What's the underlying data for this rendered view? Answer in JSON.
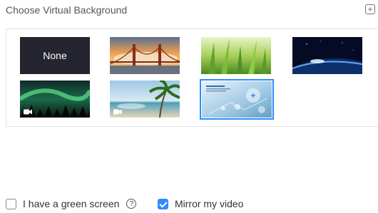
{
  "header": {
    "title": "Choose Virtual Background",
    "add_icon": "plus-icon"
  },
  "backgrounds": {
    "none_label": "None",
    "items": [
      {
        "name": "None",
        "type": "none"
      },
      {
        "name": "Golden Gate Bridge",
        "type": "image"
      },
      {
        "name": "Grass",
        "type": "image"
      },
      {
        "name": "Earth from space",
        "type": "image"
      },
      {
        "name": "Aurora",
        "type": "video"
      },
      {
        "name": "Beach",
        "type": "video"
      },
      {
        "name": "Custom medical image",
        "type": "image",
        "selected": true
      }
    ],
    "selected_color": "#2d8cff"
  },
  "options": {
    "green_screen_label": "I have a green screen",
    "green_screen_checked": false,
    "help_glyph": "?",
    "mirror_label": "Mirror my video",
    "mirror_checked": true
  },
  "colors": {
    "accent": "#2d8cff"
  }
}
